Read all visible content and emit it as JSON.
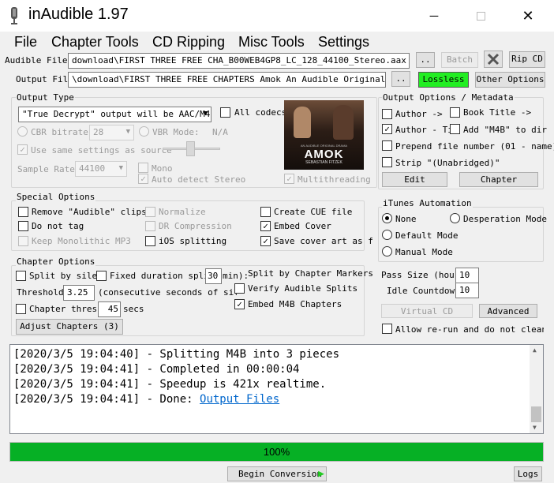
{
  "window": {
    "title": "inAudible 1.97",
    "minimize_icon": "minimize-icon",
    "maximize_icon": "maximize-icon",
    "close_icon": "close-icon",
    "app_icon": "microphone-icon"
  },
  "menu": [
    "File",
    "Chapter Tools",
    "CD Ripping",
    "Misc Tools",
    "Settings"
  ],
  "files": {
    "audible_label": "Audible File(s):",
    "audible_value": "download\\FIRST THREE FREE CHA_B00WEB4GP8_LC_128_44100_Stereo.aax",
    "output_label": "Output File:",
    "output_value": "\\download\\FIRST THREE FREE CHAPTERS Amok An Audible Original Dram",
    "browse_label": "..",
    "batch_label": "Batch",
    "tools_icon": "tools-icon",
    "ripcd_label": "Rip CD",
    "lossless_label": "Lossless",
    "other_options_label": "Other Options"
  },
  "output_type": {
    "title": "Output Type",
    "format_value": "\"True Decrypt\" output will be AAC/M4B",
    "all_codecs": "All codecs",
    "cbr_label": "CBR bitrate:",
    "cbr_value": "28",
    "vbr_label": "VBR Mode:",
    "vbr_value": "N/A",
    "same_settings": "Use same settings as source",
    "sample_rate_label": "Sample Rate:",
    "sample_rate_value": "44100",
    "mono": "Mono",
    "auto_stereo": "Auto detect Stereo",
    "multithreading": "Multithreading"
  },
  "cover": {
    "title": "AMOK",
    "credit": "SEBASTIAN FITZEK",
    "caption": "AN AUDIBLE ORIGINAL DRAMA"
  },
  "metadata": {
    "title": "Output Options / Metadata",
    "author": "Author ->",
    "book_title": "Book Title ->",
    "author_ti": "Author - Ti",
    "add_m4b": "Add \"M4B\" to dir",
    "prepend": "Prepend file number (01 - name)",
    "strip": "Strip \"(Unabridged)\"",
    "edit_label": "Edit",
    "chapter_label": "Chapter"
  },
  "special": {
    "title": "Special Options",
    "remove_clips": "Remove \"Audible\" clips",
    "normalize": "Normalize",
    "create_cue": "Create CUE file",
    "do_not_tag": "Do not tag",
    "dr_compression": "DR Compression",
    "embed_cover": "Embed Cover",
    "keep_mono": "Keep Monolithic MP3",
    "ios_split": "iOS splitting",
    "save_cover": "Save cover art as f"
  },
  "itunes": {
    "title": "iTunes Automation",
    "none": "None",
    "desperation": "Desperation Mode",
    "default": "Default Mode",
    "manual": "Manual Mode",
    "pass_size_label": "Pass Size (hours)",
    "pass_size_value": "10",
    "idle_label": "Idle Countdown",
    "idle_value": "10",
    "virtual_cd": "Virtual CD",
    "advanced": "Advanced",
    "allow_rerun": "Allow re-run and do not clean u"
  },
  "chapter": {
    "title": "Chapter Options",
    "split_silence": "Split by silen",
    "fixed_duration": "Fixed duration split",
    "fixed_value": "30",
    "fixed_unit": "min):",
    "split_markers": "Split by Chapter Markers",
    "threshold_label": "Threshold:",
    "threshold_value": "3.25",
    "threshold_desc": "(consecutive seconds of silen",
    "verify_splits": "Verify Audible Splits",
    "chapter_thresh": "Chapter thresh",
    "chapter_thresh_value": "45",
    "secs": "secs",
    "embed_chapters": "Embed M4B Chapters",
    "adjust_label": "Adjust Chapters (3)"
  },
  "log": {
    "lines": [
      "[2020/3/5 19:04:40] - Splitting M4B into 3 pieces",
      "[2020/3/5 19:04:41] - Completed in 00:00:04",
      "[2020/3/5 19:04:41] - Speedup is 421x realtime."
    ],
    "last_prefix": "[2020/3/5 19:04:41] - Done: ",
    "last_link": "Output Files"
  },
  "progress": {
    "value": 1.0,
    "label": "100%",
    "color": "#06b025"
  },
  "bottom": {
    "begin_label": "Begin Conversion",
    "play_icon": "play-arrow-icon",
    "logs_label": "Logs"
  }
}
